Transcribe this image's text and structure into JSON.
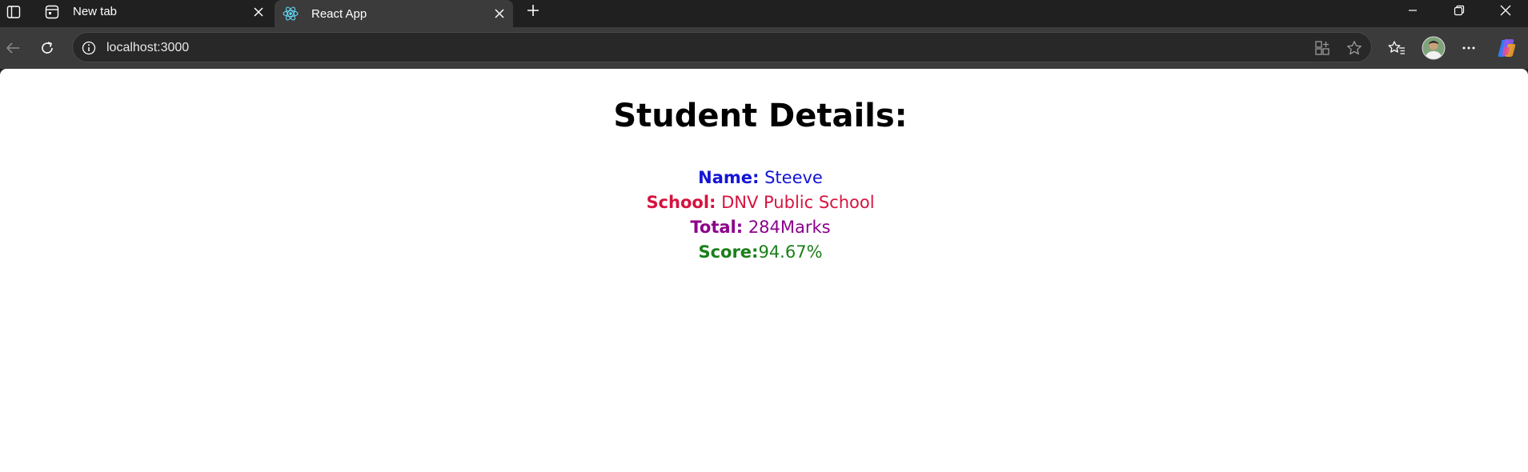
{
  "browser": {
    "tabs": [
      {
        "title": "New tab",
        "icon": "new-tab-page-icon",
        "active": false
      },
      {
        "title": "React App",
        "icon": "react-logo-icon",
        "active": true
      }
    ],
    "address_bar": {
      "url": "localhost:3000"
    },
    "colors": {
      "frame": "#202020",
      "toolbar": "#3b3b3b",
      "omnibox": "#282828"
    }
  },
  "page": {
    "heading": "Student Details:",
    "details": {
      "name_label": "Name:",
      "name_value": " Steeve",
      "school_label": "School:",
      "school_value": " DNV Public School",
      "total_label": "Total:",
      "total_value": " 284Marks",
      "score_label": "Score:",
      "score_value": "94.67%"
    },
    "colors": {
      "name": "#1414d6",
      "school": "#d6133f",
      "total": "#8b008b",
      "score": "#1a7f1a"
    }
  }
}
